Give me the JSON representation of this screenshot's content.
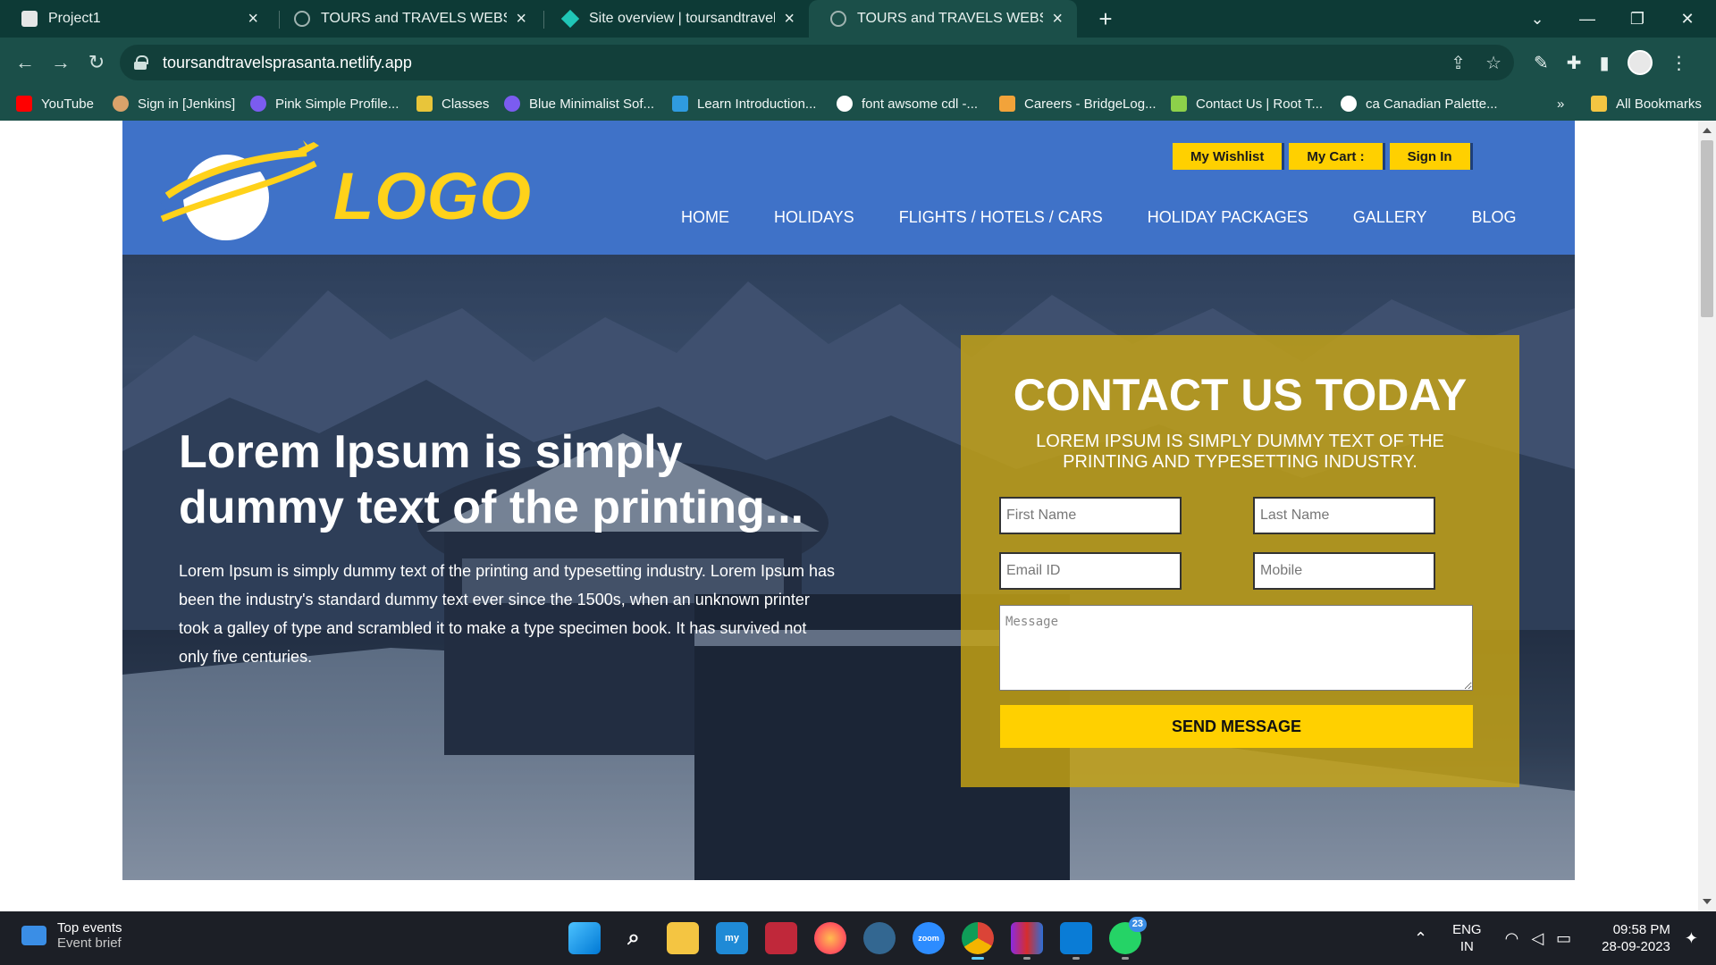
{
  "browser": {
    "tabs": [
      {
        "label": "Project1",
        "active": false
      },
      {
        "label": "TOURS and TRAVELS WEBSITE",
        "active": false
      },
      {
        "label": "Site overview | toursandtravelspr",
        "active": false
      },
      {
        "label": "TOURS and TRAVELS WEBSITE",
        "active": true
      }
    ],
    "url": "toursandtravelsprasanta.netlify.app",
    "bookmarks": [
      {
        "label": "YouTube",
        "color": "#ff0000"
      },
      {
        "label": "Sign in [Jenkins]",
        "color": "#d9a26a"
      },
      {
        "label": "Pink Simple Profile...",
        "color": "#7b5cf0"
      },
      {
        "label": "Classes",
        "color": "#e8c53a"
      },
      {
        "label": "Blue Minimalist Sof...",
        "color": "#7b5cf0"
      },
      {
        "label": "Learn Introduction...",
        "color": "#2f9be0"
      },
      {
        "label": "font awsome cdl -...",
        "color": "#ffffff"
      },
      {
        "label": "Careers - BridgeLog...",
        "color": "#f2a33a"
      },
      {
        "label": "Contact Us | Root T...",
        "color": "#8dd14a"
      },
      {
        "label": "ca Canadian Palette...",
        "color": "#ffffff"
      }
    ],
    "more_bookmarks": "»",
    "all_bookmarks": "All Bookmarks"
  },
  "site": {
    "logo_text": "LOGO",
    "top_buttons": [
      "My Wishlist",
      "My Cart :",
      "Sign In"
    ],
    "menu": [
      "HOME",
      "HOLIDAYS",
      "FLIGHTS / HOTELS / CARS",
      "HOLIDAY PACKAGES",
      "GALLERY",
      "BLOG"
    ],
    "hero": {
      "title": "Lorem Ipsum is simply dummy text of the printing...",
      "text": "Lorem Ipsum is simply dummy text of the printing and typesetting industry. Lorem Ipsum has been the industry's standard dummy text ever since the 1500s, when an unknown printer took a galley of type and scrambled it to make a type specimen book. It has survived not only five centuries."
    },
    "contact": {
      "title": "CONTACT US TODAY",
      "subtitle": "LOREM IPSUM IS SIMPLY DUMMY TEXT OF THE PRINTING AND TYPESETTING INDUSTRY.",
      "first_name_placeholder": "First Name",
      "last_name_placeholder": "Last Name",
      "email_placeholder": "Email ID",
      "mobile_placeholder": "Mobile",
      "message_placeholder": "Message",
      "send_label": "SEND MESSAGE"
    },
    "colors": {
      "header_blue": "#3f72c8",
      "accent_yellow": "#ffd000",
      "contact_panel": "#c8a514"
    }
  },
  "taskbar": {
    "widget_title": "Top events",
    "widget_sub": "Event brief",
    "whatsapp_badge": "23",
    "zoom_label": "zoom",
    "lang_top": "ENG",
    "lang_bottom": "IN",
    "time": "09:58 PM",
    "date": "28-09-2023"
  }
}
